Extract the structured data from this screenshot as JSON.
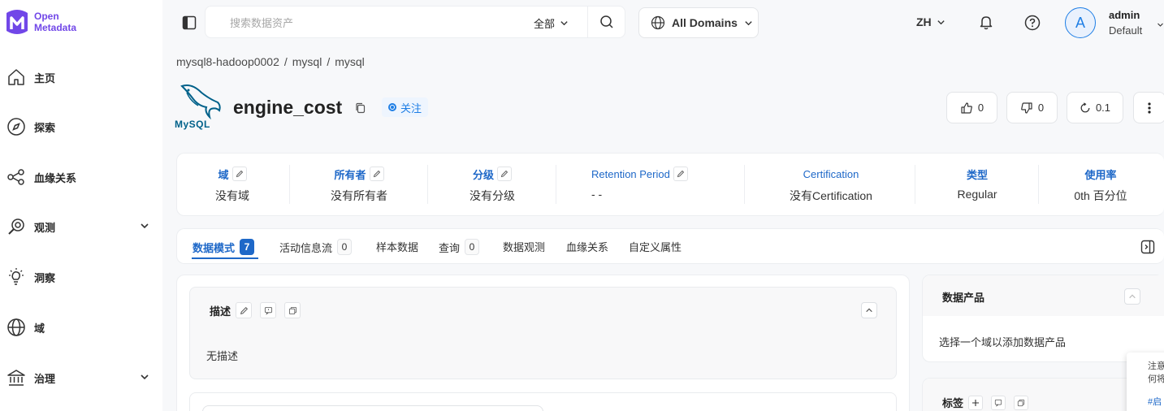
{
  "brand": {
    "line1": "Open",
    "line2": "Metadata"
  },
  "sidebar": {
    "items": [
      {
        "label": "主页",
        "icon": "home-icon",
        "expandable": false
      },
      {
        "label": "探索",
        "icon": "compass-icon",
        "expandable": false
      },
      {
        "label": "血缘关系",
        "icon": "lineage-icon",
        "expandable": false
      },
      {
        "label": "观测",
        "icon": "observe-icon",
        "expandable": true
      },
      {
        "label": "洞察",
        "icon": "insight-icon",
        "expandable": false
      },
      {
        "label": "域",
        "icon": "globe-icon",
        "expandable": false
      },
      {
        "label": "治理",
        "icon": "govern-icon",
        "expandable": true
      }
    ]
  },
  "topbar": {
    "search_placeholder": "搜索数据资产",
    "search_scope": "全部",
    "domains_label": "All Domains",
    "language": "ZH",
    "user_initial": "A",
    "user_name": "admin",
    "user_role": "Default"
  },
  "breadcrumb": [
    "mysql8-hadoop0002",
    "mysql",
    "mysql"
  ],
  "entity": {
    "service_logo_text": "MySQL",
    "name": "engine_cost",
    "follow_label": "关注",
    "likes": "0",
    "dislikes": "0",
    "version": "0.1"
  },
  "info": [
    {
      "label": "域",
      "value": "没有域"
    },
    {
      "label": "所有者",
      "value": "没有所有者"
    },
    {
      "label": "分级",
      "value": "没有分级"
    },
    {
      "label": "Retention Period",
      "value": "- -"
    },
    {
      "label": "Certification",
      "value": "没有Certification"
    },
    {
      "label": "类型",
      "value": "Regular"
    },
    {
      "label": "使用率",
      "value": "0th 百分位"
    }
  ],
  "tabs": [
    {
      "label": "数据模式",
      "count": "7"
    },
    {
      "label": "活动信息流",
      "count": "0"
    },
    {
      "label": "样本数据",
      "count": null
    },
    {
      "label": "查询",
      "count": "0"
    },
    {
      "label": "数据观测",
      "count": null
    },
    {
      "label": "血缘关系",
      "count": null
    },
    {
      "label": "自定义属性",
      "count": null
    }
  ],
  "description": {
    "title": "描述",
    "text": "无描述"
  },
  "data_products": {
    "title": "数据产品",
    "empty_text": "选择一个域以添加数据产品"
  },
  "tags": {
    "title": "标签"
  },
  "popover": {
    "line1": "注意",
    "line2": "何将",
    "link": "#启"
  },
  "colors": {
    "accent": "#1e68c8",
    "brand": "#7147e8"
  }
}
